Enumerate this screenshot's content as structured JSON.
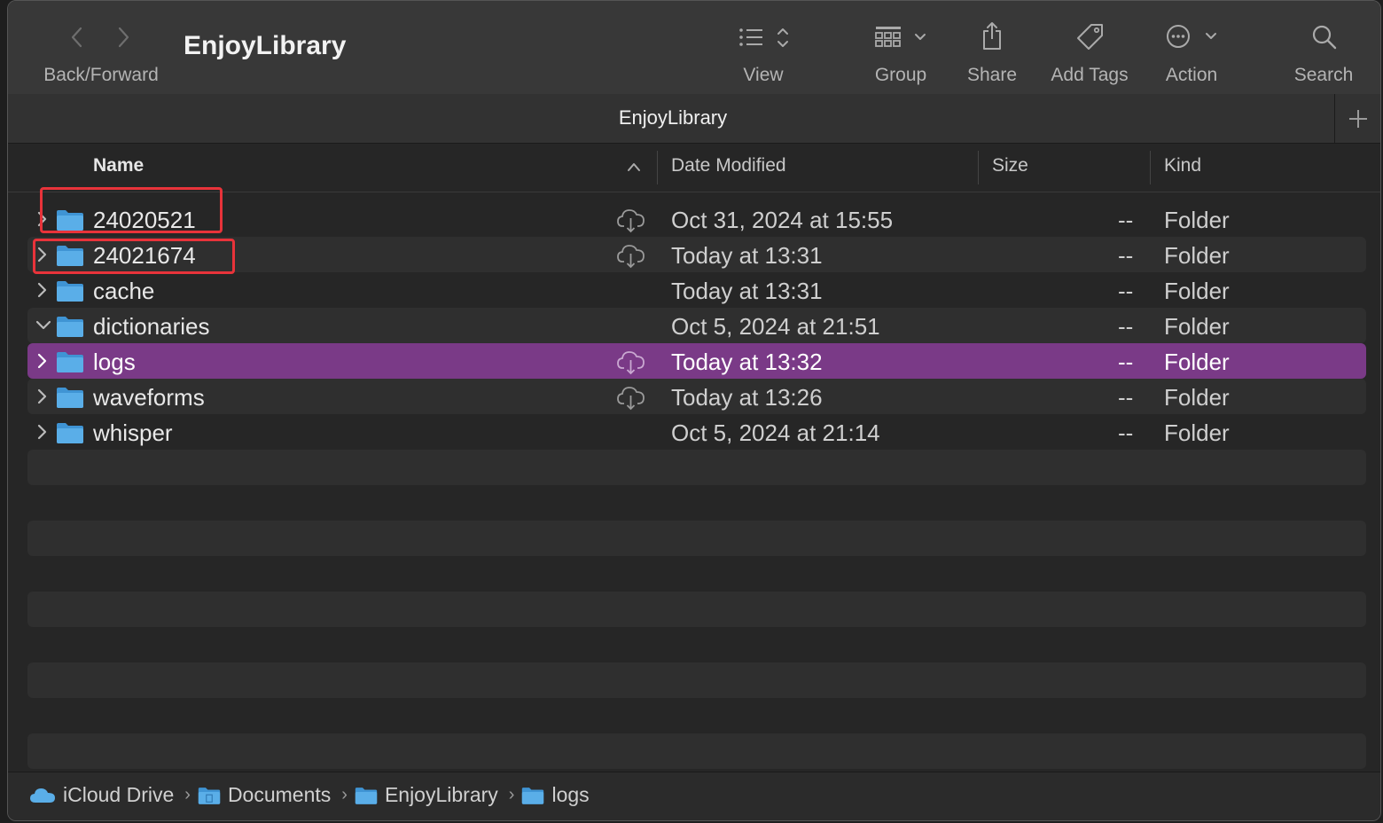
{
  "window": {
    "title": "EnjoyLibrary",
    "tab_title": "EnjoyLibrary"
  },
  "toolbar": {
    "back_forward_label": "Back/Forward",
    "view_label": "View",
    "group_label": "Group",
    "share_label": "Share",
    "add_tags_label": "Add Tags",
    "action_label": "Action",
    "search_label": "Search"
  },
  "columns": {
    "name": "Name",
    "date_modified": "Date Modified",
    "size": "Size",
    "kind": "Kind"
  },
  "rows": [
    {
      "name": "24020521",
      "date": "Oct 31, 2024 at 15:55",
      "size": "--",
      "kind": "Folder",
      "cloud": true,
      "expanded": false,
      "selected": false
    },
    {
      "name": "24021674",
      "date": "Today at 13:31",
      "size": "--",
      "kind": "Folder",
      "cloud": true,
      "expanded": false,
      "selected": false
    },
    {
      "name": "cache",
      "date": "Today at 13:31",
      "size": "--",
      "kind": "Folder",
      "cloud": false,
      "expanded": false,
      "selected": false
    },
    {
      "name": "dictionaries",
      "date": "Oct 5, 2024 at 21:51",
      "size": "--",
      "kind": "Folder",
      "cloud": false,
      "expanded": true,
      "selected": false
    },
    {
      "name": "logs",
      "date": "Today at 13:32",
      "size": "--",
      "kind": "Folder",
      "cloud": true,
      "expanded": false,
      "selected": true
    },
    {
      "name": "waveforms",
      "date": "Today at 13:26",
      "size": "--",
      "kind": "Folder",
      "cloud": true,
      "expanded": false,
      "selected": false
    },
    {
      "name": "whisper",
      "date": "Oct 5, 2024 at 21:14",
      "size": "--",
      "kind": "Folder",
      "cloud": false,
      "expanded": false,
      "selected": false
    }
  ],
  "path_bar": [
    "iCloud Drive",
    "Documents",
    "EnjoyLibrary",
    "logs"
  ],
  "colors": {
    "selection": "#7a3a87",
    "folder_blue": "#5aaee8",
    "highlight_box": "#e8333a"
  }
}
